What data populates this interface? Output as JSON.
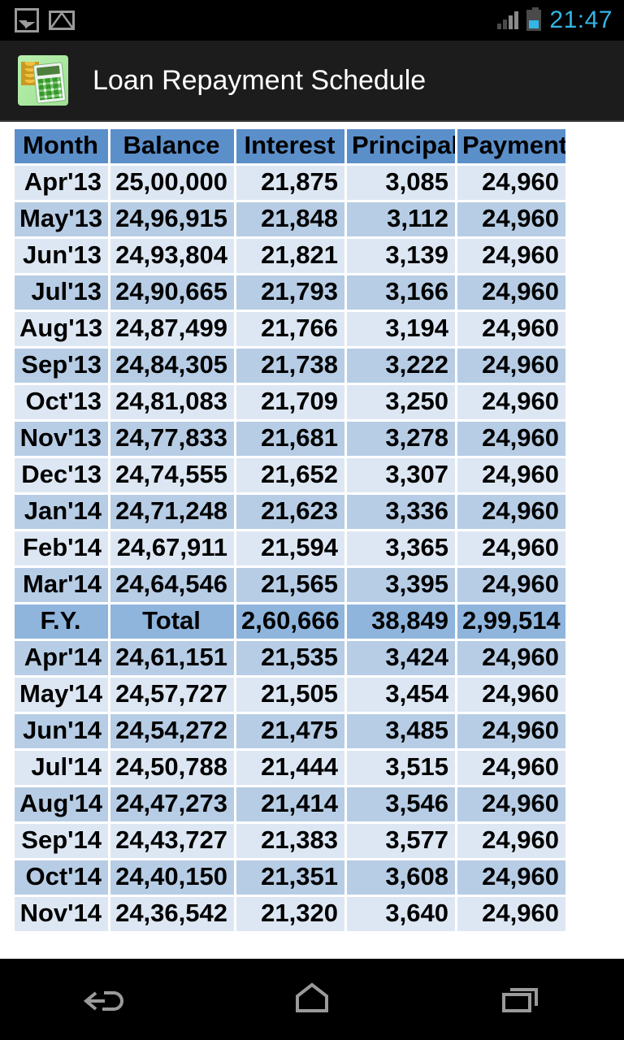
{
  "status_bar": {
    "icons": [
      "photo-icon",
      "gmail-icon",
      "signal-icon",
      "battery-icon"
    ],
    "signal_bars_filled": 2,
    "signal_bars_total": 4,
    "battery_level_pct": 50,
    "clock": "21:47",
    "clock_color": "#33b5e5"
  },
  "action_bar": {
    "app_icon": "calculator-coins-icon",
    "title": "Loan Repayment Schedule",
    "background": "#1c1c1c"
  },
  "table": {
    "header_color": "#5b8fca",
    "row_odd_color": "#dde7f3",
    "row_even_color": "#b7cde5",
    "total_row_color": "#8fb5dc",
    "columns": [
      "Month",
      "Balance",
      "Interest",
      "Principal",
      "Payment"
    ],
    "rows": [
      {
        "type": "data",
        "cells": [
          "Apr'13",
          "25,00,000",
          "21,875",
          "3,085",
          "24,960"
        ]
      },
      {
        "type": "data",
        "cells": [
          "May'13",
          "24,96,915",
          "21,848",
          "3,112",
          "24,960"
        ]
      },
      {
        "type": "data",
        "cells": [
          "Jun'13",
          "24,93,804",
          "21,821",
          "3,139",
          "24,960"
        ]
      },
      {
        "type": "data",
        "cells": [
          "Jul'13",
          "24,90,665",
          "21,793",
          "3,166",
          "24,960"
        ]
      },
      {
        "type": "data",
        "cells": [
          "Aug'13",
          "24,87,499",
          "21,766",
          "3,194",
          "24,960"
        ]
      },
      {
        "type": "data",
        "cells": [
          "Sep'13",
          "24,84,305",
          "21,738",
          "3,222",
          "24,960"
        ]
      },
      {
        "type": "data",
        "cells": [
          "Oct'13",
          "24,81,083",
          "21,709",
          "3,250",
          "24,960"
        ]
      },
      {
        "type": "data",
        "cells": [
          "Nov'13",
          "24,77,833",
          "21,681",
          "3,278",
          "24,960"
        ]
      },
      {
        "type": "data",
        "cells": [
          "Dec'13",
          "24,74,555",
          "21,652",
          "3,307",
          "24,960"
        ]
      },
      {
        "type": "data",
        "cells": [
          "Jan'14",
          "24,71,248",
          "21,623",
          "3,336",
          "24,960"
        ]
      },
      {
        "type": "data",
        "cells": [
          "Feb'14",
          "24,67,911",
          "21,594",
          "3,365",
          "24,960"
        ]
      },
      {
        "type": "data",
        "cells": [
          "Mar'14",
          "24,64,546",
          "21,565",
          "3,395",
          "24,960"
        ]
      },
      {
        "type": "total",
        "cells": [
          "F.Y.",
          "Total",
          "2,60,666",
          "38,849",
          "2,99,514"
        ]
      },
      {
        "type": "data",
        "cells": [
          "Apr'14",
          "24,61,151",
          "21,535",
          "3,424",
          "24,960"
        ]
      },
      {
        "type": "data",
        "cells": [
          "May'14",
          "24,57,727",
          "21,505",
          "3,454",
          "24,960"
        ]
      },
      {
        "type": "data",
        "cells": [
          "Jun'14",
          "24,54,272",
          "21,475",
          "3,485",
          "24,960"
        ]
      },
      {
        "type": "data",
        "cells": [
          "Jul'14",
          "24,50,788",
          "21,444",
          "3,515",
          "24,960"
        ]
      },
      {
        "type": "data",
        "cells": [
          "Aug'14",
          "24,47,273",
          "21,414",
          "3,546",
          "24,960"
        ]
      },
      {
        "type": "data",
        "cells": [
          "Sep'14",
          "24,43,727",
          "21,383",
          "3,577",
          "24,960"
        ]
      },
      {
        "type": "data",
        "cells": [
          "Oct'14",
          "24,40,150",
          "21,351",
          "3,608",
          "24,960"
        ]
      },
      {
        "type": "data",
        "cells": [
          "Nov'14",
          "24,36,542",
          "21,320",
          "3,640",
          "24,960"
        ]
      }
    ]
  },
  "nav_bar": {
    "buttons": [
      "back-icon",
      "home-icon",
      "recents-icon"
    ],
    "background": "#000000"
  }
}
